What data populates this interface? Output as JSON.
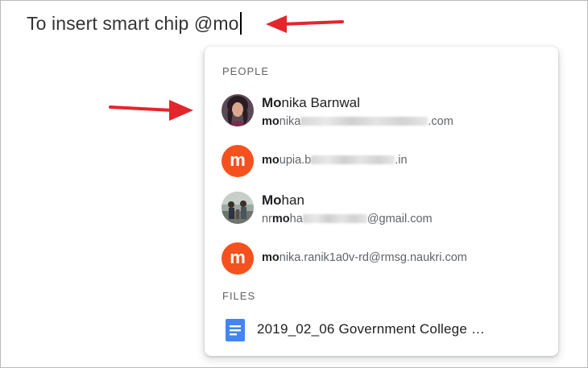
{
  "document": {
    "typed_text": "To insert smart chip @mo"
  },
  "suggestions": {
    "people_label": "PEOPLE",
    "people": [
      {
        "name_bold": "Mo",
        "name_rest": "nika Barnwal",
        "email_bold": "mo",
        "email_pre": "nika",
        "email_post": ".com",
        "avatar": "profile-photo-woman"
      },
      {
        "email_bold": "mo",
        "email_pre": "upia.b",
        "email_post": ".in",
        "avatar_letter": "m",
        "avatar_color": "#f4511e"
      },
      {
        "name_bold": "Mo",
        "name_rest": "han",
        "email_lead": "nr",
        "email_bold": "mo",
        "email_pre": "ha",
        "email_post": "@gmail.com",
        "avatar": "profile-photo-group"
      },
      {
        "email_bold": "mo",
        "email_rest": "nika.ranik1a0v-rd@rmsg.naukri.com",
        "avatar_letter": "m",
        "avatar_color": "#f4511e"
      }
    ],
    "files_label": "FILES",
    "files": [
      {
        "name": "2019_02_06 Government College …",
        "icon": "google-docs-icon"
      }
    ]
  },
  "annotation": {
    "arrow_color": "#e3262c"
  }
}
